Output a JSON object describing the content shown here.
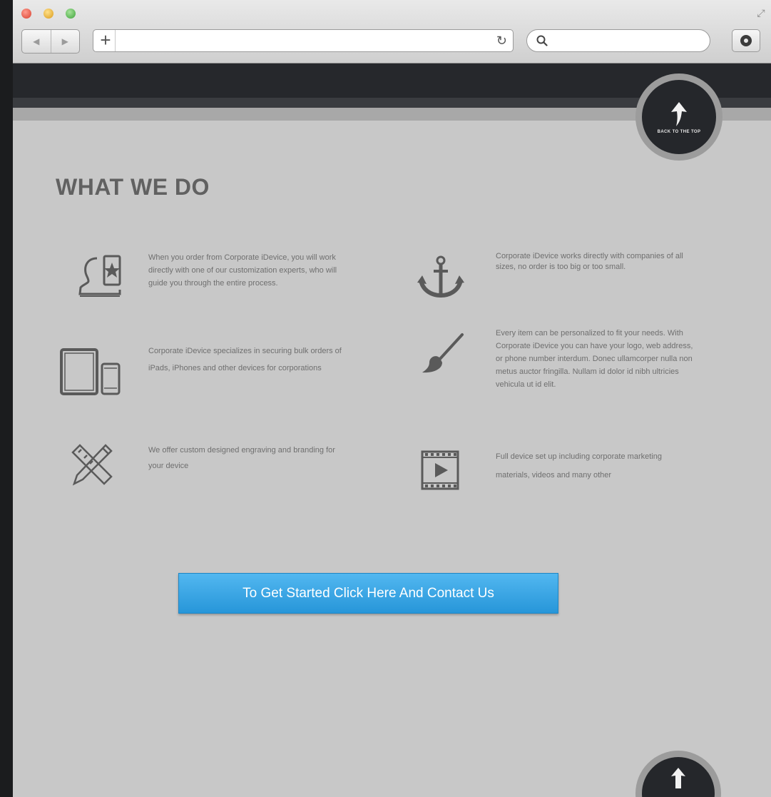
{
  "browser": {
    "address_value": "",
    "search_value": ""
  },
  "page": {
    "back_to_top_label": "BACK TO THE TOP",
    "heading": "WHAT WE DO",
    "features": [
      {
        "icon": "customer-expert-icon",
        "text": "When you order from Corporate iDevice, you will work directly with one of our customization experts, who will guide you through the entire process."
      },
      {
        "icon": "anchor-icon",
        "text": "Corporate iDevice works directly with companies of all sizes, no order is too big or too small."
      },
      {
        "icon": "devices-icon",
        "text": "Corporate iDevice specializes in securing bulk orders of iPads, iPhones and other devices for corporations"
      },
      {
        "icon": "paintbrush-icon",
        "text": "Every item can be personalized to fit your needs. With Corporate iDevice you can have your logo, web address, or phone number interdum. Donec ullamcorper nulla non metus auctor fringilla. Nullam id dolor id nibh ultricies vehicula ut id elit."
      },
      {
        "icon": "pencil-ruler-icon",
        "text": "We offer custom designed engraving and branding for your device"
      },
      {
        "icon": "video-icon",
        "text": "Full device set up including corporate marketing materials, videos and many other"
      }
    ],
    "cta_label": "To Get Started Click Here And Contact Us"
  }
}
